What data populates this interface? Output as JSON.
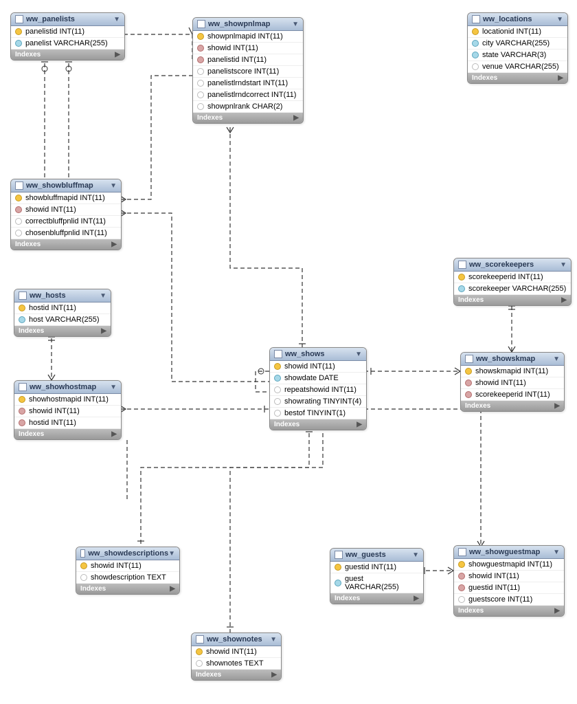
{
  "labels": {
    "indexes": "Indexes"
  },
  "tables": {
    "panelists": {
      "name": "ww_panelists",
      "cols": [
        {
          "k": "key",
          "txt": "panelistid INT(11)"
        },
        {
          "k": "dia",
          "txt": "panelist VARCHAR(255)"
        }
      ]
    },
    "showpnlmap": {
      "name": "ww_showpnlmap",
      "cols": [
        {
          "k": "key",
          "txt": "showpnlmapid INT(11)"
        },
        {
          "k": "fk",
          "txt": "showid INT(11)"
        },
        {
          "k": "fk",
          "txt": "panelistid INT(11)"
        },
        {
          "k": "plain",
          "txt": "panelistscore INT(11)"
        },
        {
          "k": "plain",
          "txt": "panelistlrndstart INT(11)"
        },
        {
          "k": "plain",
          "txt": "panelistlrndcorrect INT(11)"
        },
        {
          "k": "plain",
          "txt": "showpnlrank CHAR(2)"
        }
      ]
    },
    "locations": {
      "name": "ww_locations",
      "cols": [
        {
          "k": "key",
          "txt": "locationid INT(11)"
        },
        {
          "k": "dia",
          "txt": "city VARCHAR(255)"
        },
        {
          "k": "dia",
          "txt": "state VARCHAR(3)"
        },
        {
          "k": "plain",
          "txt": "venue VARCHAR(255)"
        }
      ]
    },
    "showbluffmap": {
      "name": "ww_showbluffmap",
      "cols": [
        {
          "k": "key",
          "txt": "showbluffmapid INT(11)"
        },
        {
          "k": "fk",
          "txt": "showid INT(11)"
        },
        {
          "k": "plain",
          "txt": "correctbluffpnlid INT(11)"
        },
        {
          "k": "plain",
          "txt": "chosenbluffpnlid INT(11)"
        }
      ]
    },
    "hosts": {
      "name": "ww_hosts",
      "cols": [
        {
          "k": "key",
          "txt": "hostid INT(11)"
        },
        {
          "k": "dia",
          "txt": "host VARCHAR(255)"
        }
      ]
    },
    "scorekeepers": {
      "name": "ww_scorekeepers",
      "cols": [
        {
          "k": "key",
          "txt": "scorekeeperid INT(11)"
        },
        {
          "k": "dia",
          "txt": "scorekeeper VARCHAR(255)"
        }
      ]
    },
    "shows": {
      "name": "ww_shows",
      "cols": [
        {
          "k": "key",
          "txt": "showid INT(11)"
        },
        {
          "k": "dia",
          "txt": "showdate DATE"
        },
        {
          "k": "plain",
          "txt": "repeatshowid INT(11)"
        },
        {
          "k": "plain",
          "txt": "showrating TINYINT(4)"
        },
        {
          "k": "plain",
          "txt": "bestof TINYINT(1)"
        }
      ]
    },
    "showskmap": {
      "name": "ww_showskmap",
      "cols": [
        {
          "k": "key",
          "txt": "showskmapid INT(11)"
        },
        {
          "k": "fk",
          "txt": "showid INT(11)"
        },
        {
          "k": "fk",
          "txt": "scorekeeperid INT(11)"
        }
      ]
    },
    "showhostmap": {
      "name": "ww_showhostmap",
      "cols": [
        {
          "k": "key",
          "txt": "showhostmapid INT(11)"
        },
        {
          "k": "fk",
          "txt": "showid INT(11)"
        },
        {
          "k": "fk",
          "txt": "hostid INT(11)"
        }
      ]
    },
    "showdescriptions": {
      "name": "ww_showdescriptions",
      "cols": [
        {
          "k": "key",
          "txt": "showid INT(11)"
        },
        {
          "k": "plain",
          "txt": "showdescription TEXT"
        }
      ]
    },
    "guests": {
      "name": "ww_guests",
      "cols": [
        {
          "k": "key",
          "txt": "guestid INT(11)"
        },
        {
          "k": "dia",
          "txt": "guest VARCHAR(255)"
        }
      ]
    },
    "showguestmap": {
      "name": "ww_showguestmap",
      "cols": [
        {
          "k": "key",
          "txt": "showguestmapid INT(11)"
        },
        {
          "k": "fk",
          "txt": "showid INT(11)"
        },
        {
          "k": "fk",
          "txt": "guestid INT(11)"
        },
        {
          "k": "plain",
          "txt": "guestscore INT(11)"
        }
      ]
    },
    "shownotes": {
      "name": "ww_shownotes",
      "cols": [
        {
          "k": "key",
          "txt": "showid INT(11)"
        },
        {
          "k": "plain",
          "txt": "shownotes TEXT"
        }
      ]
    }
  }
}
